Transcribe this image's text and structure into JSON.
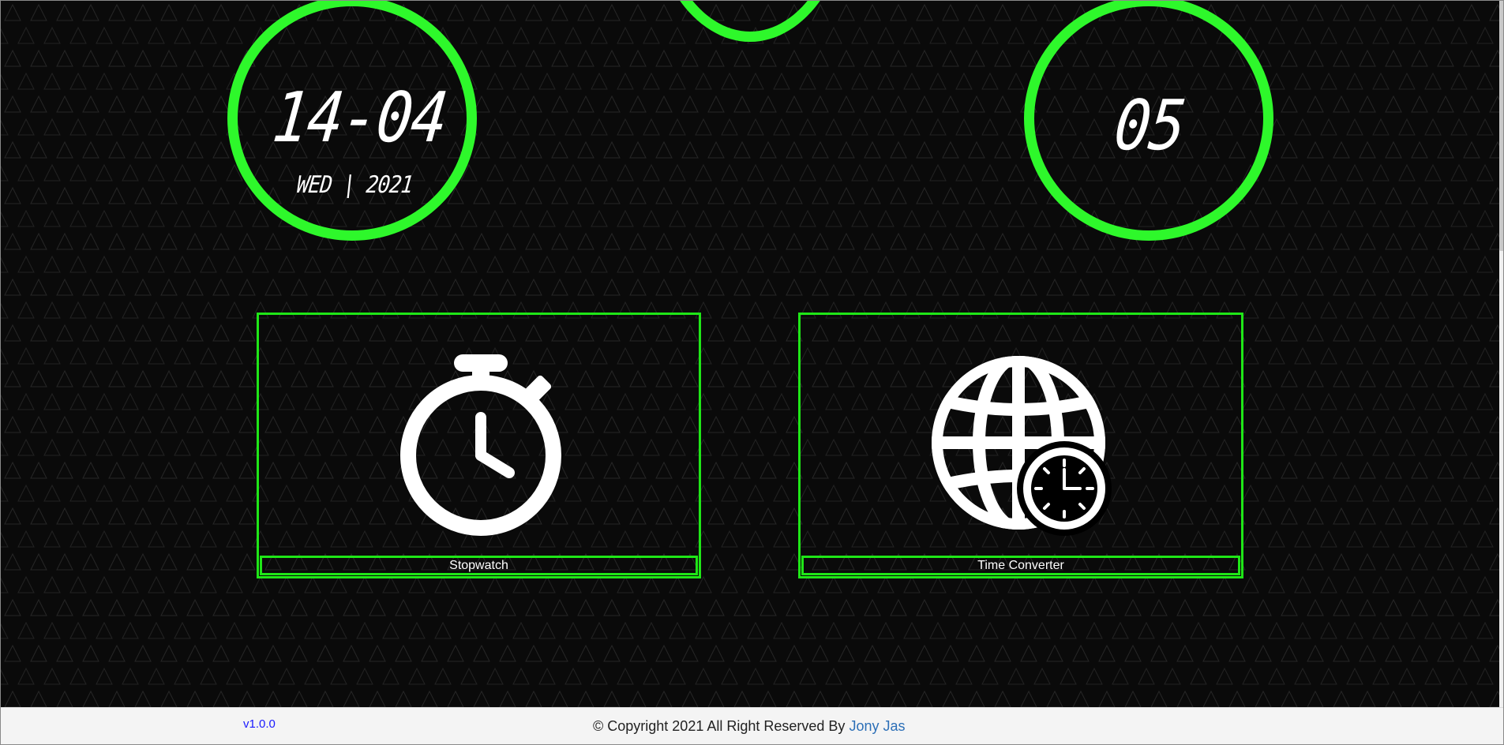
{
  "clock": {
    "date": "14-04",
    "day_year": "WED | 2021",
    "hour": "05"
  },
  "tiles": [
    {
      "caption": "Stopwatch",
      "icon": "stopwatch-icon"
    },
    {
      "caption": "Time Converter",
      "icon": "globe-clock-icon"
    }
  ],
  "footer": {
    "version": "v1.0.0",
    "copyright_text": "© Copyright 2021 All Right Reserved By",
    "author": "Jony Jas"
  },
  "colors": {
    "accent": "#2ef82b",
    "background": "#0a0a0a",
    "link": "#2c6fb7"
  }
}
